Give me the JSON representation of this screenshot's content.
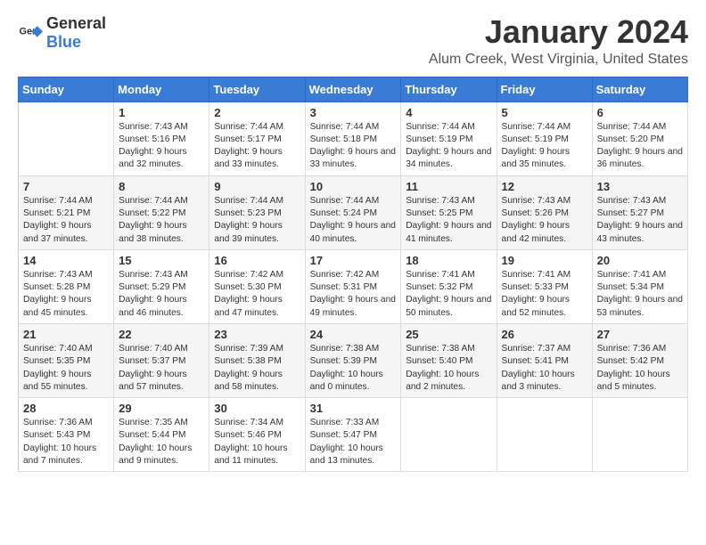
{
  "header": {
    "logo_general": "General",
    "logo_blue": "Blue",
    "month_title": "January 2024",
    "location": "Alum Creek, West Virginia, United States"
  },
  "columns": [
    "Sunday",
    "Monday",
    "Tuesday",
    "Wednesday",
    "Thursday",
    "Friday",
    "Saturday"
  ],
  "weeks": [
    [
      {
        "day": "",
        "sunrise": "",
        "sunset": "",
        "daylight": ""
      },
      {
        "day": "1",
        "sunrise": "Sunrise: 7:43 AM",
        "sunset": "Sunset: 5:16 PM",
        "daylight": "Daylight: 9 hours and 32 minutes."
      },
      {
        "day": "2",
        "sunrise": "Sunrise: 7:44 AM",
        "sunset": "Sunset: 5:17 PM",
        "daylight": "Daylight: 9 hours and 33 minutes."
      },
      {
        "day": "3",
        "sunrise": "Sunrise: 7:44 AM",
        "sunset": "Sunset: 5:18 PM",
        "daylight": "Daylight: 9 hours and 33 minutes."
      },
      {
        "day": "4",
        "sunrise": "Sunrise: 7:44 AM",
        "sunset": "Sunset: 5:19 PM",
        "daylight": "Daylight: 9 hours and 34 minutes."
      },
      {
        "day": "5",
        "sunrise": "Sunrise: 7:44 AM",
        "sunset": "Sunset: 5:19 PM",
        "daylight": "Daylight: 9 hours and 35 minutes."
      },
      {
        "day": "6",
        "sunrise": "Sunrise: 7:44 AM",
        "sunset": "Sunset: 5:20 PM",
        "daylight": "Daylight: 9 hours and 36 minutes."
      }
    ],
    [
      {
        "day": "7",
        "sunrise": "Sunrise: 7:44 AM",
        "sunset": "Sunset: 5:21 PM",
        "daylight": "Daylight: 9 hours and 37 minutes."
      },
      {
        "day": "8",
        "sunrise": "Sunrise: 7:44 AM",
        "sunset": "Sunset: 5:22 PM",
        "daylight": "Daylight: 9 hours and 38 minutes."
      },
      {
        "day": "9",
        "sunrise": "Sunrise: 7:44 AM",
        "sunset": "Sunset: 5:23 PM",
        "daylight": "Daylight: 9 hours and 39 minutes."
      },
      {
        "day": "10",
        "sunrise": "Sunrise: 7:44 AM",
        "sunset": "Sunset: 5:24 PM",
        "daylight": "Daylight: 9 hours and 40 minutes."
      },
      {
        "day": "11",
        "sunrise": "Sunrise: 7:43 AM",
        "sunset": "Sunset: 5:25 PM",
        "daylight": "Daylight: 9 hours and 41 minutes."
      },
      {
        "day": "12",
        "sunrise": "Sunrise: 7:43 AM",
        "sunset": "Sunset: 5:26 PM",
        "daylight": "Daylight: 9 hours and 42 minutes."
      },
      {
        "day": "13",
        "sunrise": "Sunrise: 7:43 AM",
        "sunset": "Sunset: 5:27 PM",
        "daylight": "Daylight: 9 hours and 43 minutes."
      }
    ],
    [
      {
        "day": "14",
        "sunrise": "Sunrise: 7:43 AM",
        "sunset": "Sunset: 5:28 PM",
        "daylight": "Daylight: 9 hours and 45 minutes."
      },
      {
        "day": "15",
        "sunrise": "Sunrise: 7:43 AM",
        "sunset": "Sunset: 5:29 PM",
        "daylight": "Daylight: 9 hours and 46 minutes."
      },
      {
        "day": "16",
        "sunrise": "Sunrise: 7:42 AM",
        "sunset": "Sunset: 5:30 PM",
        "daylight": "Daylight: 9 hours and 47 minutes."
      },
      {
        "day": "17",
        "sunrise": "Sunrise: 7:42 AM",
        "sunset": "Sunset: 5:31 PM",
        "daylight": "Daylight: 9 hours and 49 minutes."
      },
      {
        "day": "18",
        "sunrise": "Sunrise: 7:41 AM",
        "sunset": "Sunset: 5:32 PM",
        "daylight": "Daylight: 9 hours and 50 minutes."
      },
      {
        "day": "19",
        "sunrise": "Sunrise: 7:41 AM",
        "sunset": "Sunset: 5:33 PM",
        "daylight": "Daylight: 9 hours and 52 minutes."
      },
      {
        "day": "20",
        "sunrise": "Sunrise: 7:41 AM",
        "sunset": "Sunset: 5:34 PM",
        "daylight": "Daylight: 9 hours and 53 minutes."
      }
    ],
    [
      {
        "day": "21",
        "sunrise": "Sunrise: 7:40 AM",
        "sunset": "Sunset: 5:35 PM",
        "daylight": "Daylight: 9 hours and 55 minutes."
      },
      {
        "day": "22",
        "sunrise": "Sunrise: 7:40 AM",
        "sunset": "Sunset: 5:37 PM",
        "daylight": "Daylight: 9 hours and 57 minutes."
      },
      {
        "day": "23",
        "sunrise": "Sunrise: 7:39 AM",
        "sunset": "Sunset: 5:38 PM",
        "daylight": "Daylight: 9 hours and 58 minutes."
      },
      {
        "day": "24",
        "sunrise": "Sunrise: 7:38 AM",
        "sunset": "Sunset: 5:39 PM",
        "daylight": "Daylight: 10 hours and 0 minutes."
      },
      {
        "day": "25",
        "sunrise": "Sunrise: 7:38 AM",
        "sunset": "Sunset: 5:40 PM",
        "daylight": "Daylight: 10 hours and 2 minutes."
      },
      {
        "day": "26",
        "sunrise": "Sunrise: 7:37 AM",
        "sunset": "Sunset: 5:41 PM",
        "daylight": "Daylight: 10 hours and 3 minutes."
      },
      {
        "day": "27",
        "sunrise": "Sunrise: 7:36 AM",
        "sunset": "Sunset: 5:42 PM",
        "daylight": "Daylight: 10 hours and 5 minutes."
      }
    ],
    [
      {
        "day": "28",
        "sunrise": "Sunrise: 7:36 AM",
        "sunset": "Sunset: 5:43 PM",
        "daylight": "Daylight: 10 hours and 7 minutes."
      },
      {
        "day": "29",
        "sunrise": "Sunrise: 7:35 AM",
        "sunset": "Sunset: 5:44 PM",
        "daylight": "Daylight: 10 hours and 9 minutes."
      },
      {
        "day": "30",
        "sunrise": "Sunrise: 7:34 AM",
        "sunset": "Sunset: 5:46 PM",
        "daylight": "Daylight: 10 hours and 11 minutes."
      },
      {
        "day": "31",
        "sunrise": "Sunrise: 7:33 AM",
        "sunset": "Sunset: 5:47 PM",
        "daylight": "Daylight: 10 hours and 13 minutes."
      },
      {
        "day": "",
        "sunrise": "",
        "sunset": "",
        "daylight": ""
      },
      {
        "day": "",
        "sunrise": "",
        "sunset": "",
        "daylight": ""
      },
      {
        "day": "",
        "sunrise": "",
        "sunset": "",
        "daylight": ""
      }
    ]
  ]
}
